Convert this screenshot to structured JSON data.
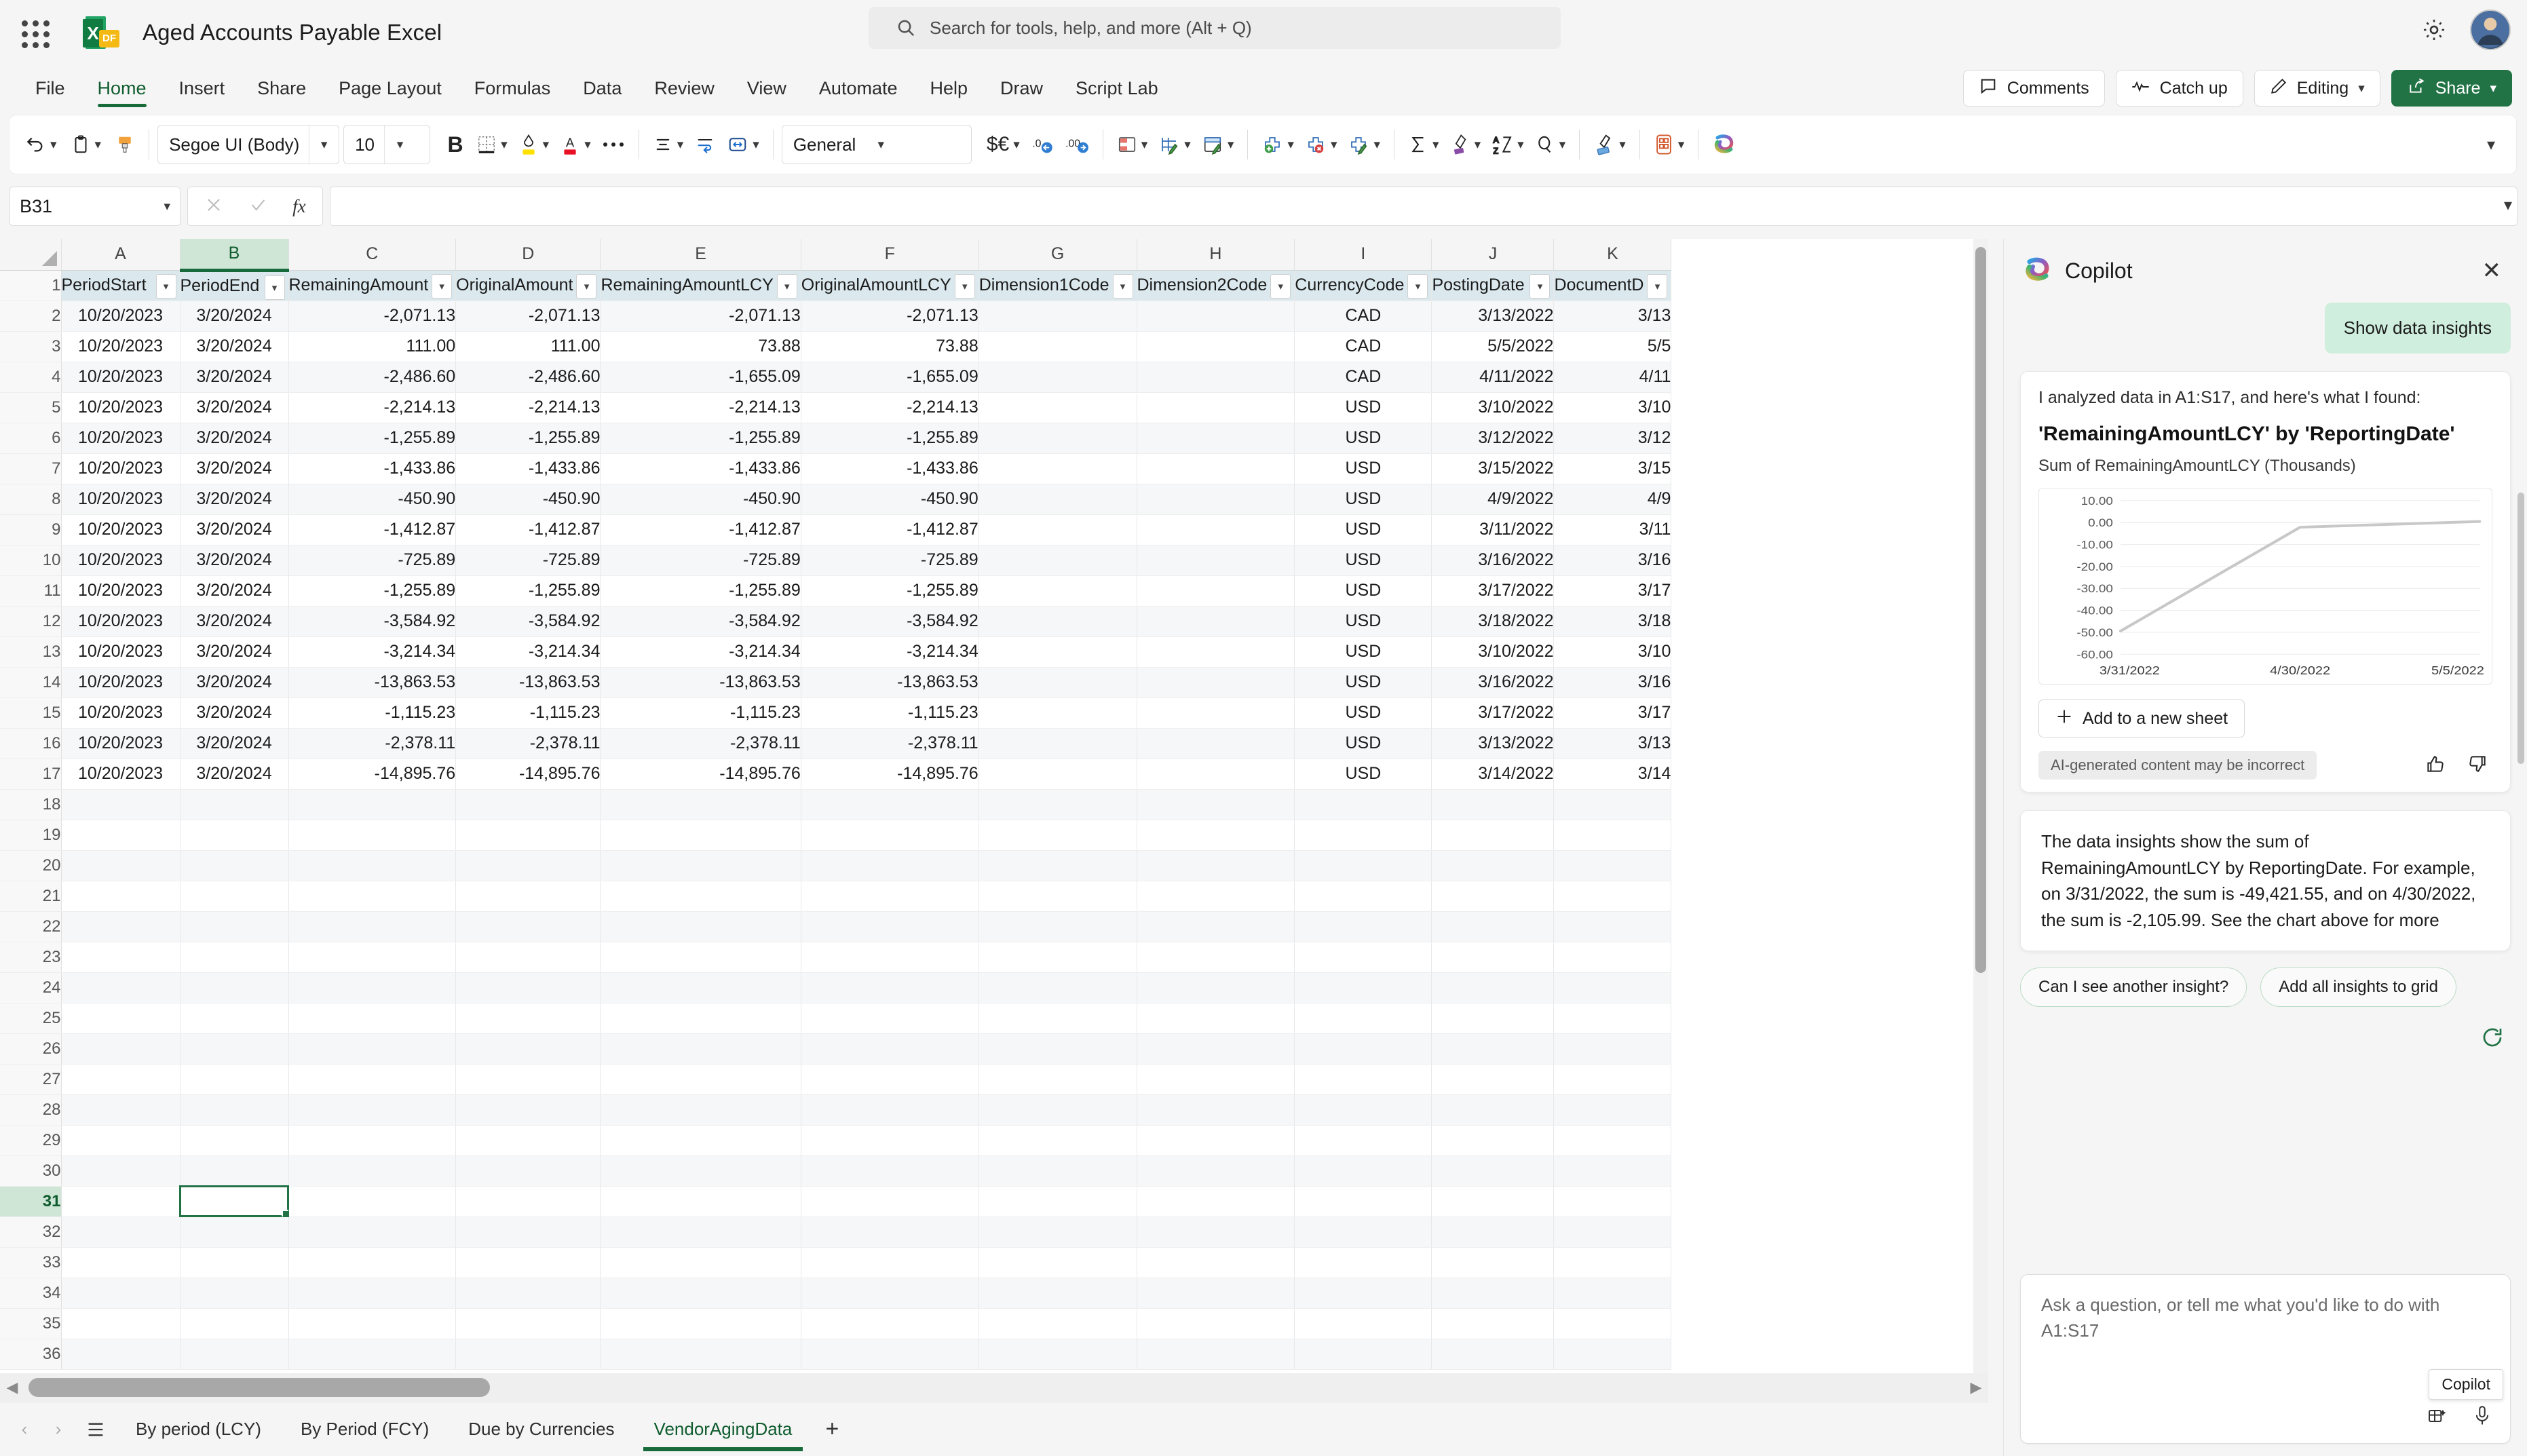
{
  "titlebar": {
    "waffle_label": "App launcher",
    "doc_title": "Aged Accounts Payable Excel",
    "search_placeholder": "Search for tools, help, and more (Alt + Q)"
  },
  "ribbon": {
    "tabs": [
      {
        "label": "File",
        "active": false
      },
      {
        "label": "Home",
        "active": true
      },
      {
        "label": "Insert",
        "active": false
      },
      {
        "label": "Share",
        "active": false
      },
      {
        "label": "Page Layout",
        "active": false
      },
      {
        "label": "Formulas",
        "active": false
      },
      {
        "label": "Data",
        "active": false
      },
      {
        "label": "Review",
        "active": false
      },
      {
        "label": "View",
        "active": false
      },
      {
        "label": "Automate",
        "active": false
      },
      {
        "label": "Help",
        "active": false
      },
      {
        "label": "Draw",
        "active": false
      },
      {
        "label": "Script Lab",
        "active": false
      }
    ],
    "comments_label": "Comments",
    "catchup_label": "Catch up",
    "editing_label": "Editing",
    "share_label": "Share",
    "accent_color": "#217346"
  },
  "toolbar": {
    "font_name": "Segoe UI (Body)",
    "font_size": "10",
    "bold_label": "B",
    "number_format": "General"
  },
  "formulabar": {
    "name_box": "B31",
    "formula_value": ""
  },
  "grid": {
    "columns": [
      "A",
      "B",
      "C",
      "D",
      "E",
      "F",
      "G",
      "H",
      "I",
      "J",
      "K"
    ],
    "selected_column": "B",
    "selected_row": 31,
    "selected_cell": "B31",
    "headers": [
      "PeriodStart",
      "PeriodEnd",
      "RemainingAmount",
      "OriginalAmount",
      "RemainingAmountLCY",
      "OriginalAmountLCY",
      "Dimension1Code",
      "Dimension2Code",
      "CurrencyCode",
      "PostingDate",
      "DocumentD"
    ],
    "rows": [
      {
        "n": 2,
        "cells": [
          "10/20/2023",
          "3/20/2024",
          "-2,071.13",
          "-2,071.13",
          "-2,071.13",
          "-2,071.13",
          "",
          "",
          "CAD",
          "3/13/2022",
          "3/13"
        ]
      },
      {
        "n": 3,
        "cells": [
          "10/20/2023",
          "3/20/2024",
          "111.00",
          "111.00",
          "73.88",
          "73.88",
          "",
          "",
          "CAD",
          "5/5/2022",
          "5/5"
        ]
      },
      {
        "n": 4,
        "cells": [
          "10/20/2023",
          "3/20/2024",
          "-2,486.60",
          "-2,486.60",
          "-1,655.09",
          "-1,655.09",
          "",
          "",
          "CAD",
          "4/11/2022",
          "4/11"
        ]
      },
      {
        "n": 5,
        "cells": [
          "10/20/2023",
          "3/20/2024",
          "-2,214.13",
          "-2,214.13",
          "-2,214.13",
          "-2,214.13",
          "",
          "",
          "USD",
          "3/10/2022",
          "3/10"
        ]
      },
      {
        "n": 6,
        "cells": [
          "10/20/2023",
          "3/20/2024",
          "-1,255.89",
          "-1,255.89",
          "-1,255.89",
          "-1,255.89",
          "",
          "",
          "USD",
          "3/12/2022",
          "3/12"
        ]
      },
      {
        "n": 7,
        "cells": [
          "10/20/2023",
          "3/20/2024",
          "-1,433.86",
          "-1,433.86",
          "-1,433.86",
          "-1,433.86",
          "",
          "",
          "USD",
          "3/15/2022",
          "3/15"
        ]
      },
      {
        "n": 8,
        "cells": [
          "10/20/2023",
          "3/20/2024",
          "-450.90",
          "-450.90",
          "-450.90",
          "-450.90",
          "",
          "",
          "USD",
          "4/9/2022",
          "4/9"
        ]
      },
      {
        "n": 9,
        "cells": [
          "10/20/2023",
          "3/20/2024",
          "-1,412.87",
          "-1,412.87",
          "-1,412.87",
          "-1,412.87",
          "",
          "",
          "USD",
          "3/11/2022",
          "3/11"
        ]
      },
      {
        "n": 10,
        "cells": [
          "10/20/2023",
          "3/20/2024",
          "-725.89",
          "-725.89",
          "-725.89",
          "-725.89",
          "",
          "",
          "USD",
          "3/16/2022",
          "3/16"
        ]
      },
      {
        "n": 11,
        "cells": [
          "10/20/2023",
          "3/20/2024",
          "-1,255.89",
          "-1,255.89",
          "-1,255.89",
          "-1,255.89",
          "",
          "",
          "USD",
          "3/17/2022",
          "3/17"
        ]
      },
      {
        "n": 12,
        "cells": [
          "10/20/2023",
          "3/20/2024",
          "-3,584.92",
          "-3,584.92",
          "-3,584.92",
          "-3,584.92",
          "",
          "",
          "USD",
          "3/18/2022",
          "3/18"
        ]
      },
      {
        "n": 13,
        "cells": [
          "10/20/2023",
          "3/20/2024",
          "-3,214.34",
          "-3,214.34",
          "-3,214.34",
          "-3,214.34",
          "",
          "",
          "USD",
          "3/10/2022",
          "3/10"
        ]
      },
      {
        "n": 14,
        "cells": [
          "10/20/2023",
          "3/20/2024",
          "-13,863.53",
          "-13,863.53",
          "-13,863.53",
          "-13,863.53",
          "",
          "",
          "USD",
          "3/16/2022",
          "3/16"
        ]
      },
      {
        "n": 15,
        "cells": [
          "10/20/2023",
          "3/20/2024",
          "-1,115.23",
          "-1,115.23",
          "-1,115.23",
          "-1,115.23",
          "",
          "",
          "USD",
          "3/17/2022",
          "3/17"
        ]
      },
      {
        "n": 16,
        "cells": [
          "10/20/2023",
          "3/20/2024",
          "-2,378.11",
          "-2,378.11",
          "-2,378.11",
          "-2,378.11",
          "",
          "",
          "USD",
          "3/13/2022",
          "3/13"
        ]
      },
      {
        "n": 17,
        "cells": [
          "10/20/2023",
          "3/20/2024",
          "-14,895.76",
          "-14,895.76",
          "-14,895.76",
          "-14,895.76",
          "",
          "",
          "USD",
          "3/14/2022",
          "3/14"
        ]
      },
      {
        "n": 18,
        "cells": [
          "",
          "",
          "",
          "",
          "",
          "",
          "",
          "",
          "",
          "",
          ""
        ]
      },
      {
        "n": 19,
        "cells": [
          "",
          "",
          "",
          "",
          "",
          "",
          "",
          "",
          "",
          "",
          ""
        ]
      },
      {
        "n": 20,
        "cells": [
          "",
          "",
          "",
          "",
          "",
          "",
          "",
          "",
          "",
          "",
          ""
        ]
      },
      {
        "n": 21,
        "cells": [
          "",
          "",
          "",
          "",
          "",
          "",
          "",
          "",
          "",
          "",
          ""
        ]
      },
      {
        "n": 22,
        "cells": [
          "",
          "",
          "",
          "",
          "",
          "",
          "",
          "",
          "",
          "",
          ""
        ]
      },
      {
        "n": 23,
        "cells": [
          "",
          "",
          "",
          "",
          "",
          "",
          "",
          "",
          "",
          "",
          ""
        ]
      },
      {
        "n": 24,
        "cells": [
          "",
          "",
          "",
          "",
          "",
          "",
          "",
          "",
          "",
          "",
          ""
        ]
      },
      {
        "n": 25,
        "cells": [
          "",
          "",
          "",
          "",
          "",
          "",
          "",
          "",
          "",
          "",
          ""
        ]
      },
      {
        "n": 26,
        "cells": [
          "",
          "",
          "",
          "",
          "",
          "",
          "",
          "",
          "",
          "",
          ""
        ]
      },
      {
        "n": 27,
        "cells": [
          "",
          "",
          "",
          "",
          "",
          "",
          "",
          "",
          "",
          "",
          ""
        ]
      },
      {
        "n": 28,
        "cells": [
          "",
          "",
          "",
          "",
          "",
          "",
          "",
          "",
          "",
          "",
          ""
        ]
      },
      {
        "n": 29,
        "cells": [
          "",
          "",
          "",
          "",
          "",
          "",
          "",
          "",
          "",
          "",
          ""
        ]
      },
      {
        "n": 30,
        "cells": [
          "",
          "",
          "",
          "",
          "",
          "",
          "",
          "",
          "",
          "",
          ""
        ]
      },
      {
        "n": 31,
        "cells": [
          "",
          "",
          "",
          "",
          "",
          "",
          "",
          "",
          "",
          "",
          ""
        ]
      },
      {
        "n": 32,
        "cells": [
          "",
          "",
          "",
          "",
          "",
          "",
          "",
          "",
          "",
          "",
          ""
        ]
      },
      {
        "n": 33,
        "cells": [
          "",
          "",
          "",
          "",
          "",
          "",
          "",
          "",
          "",
          "",
          ""
        ]
      },
      {
        "n": 34,
        "cells": [
          "",
          "",
          "",
          "",
          "",
          "",
          "",
          "",
          "",
          "",
          ""
        ]
      },
      {
        "n": 35,
        "cells": [
          "",
          "",
          "",
          "",
          "",
          "",
          "",
          "",
          "",
          "",
          ""
        ]
      },
      {
        "n": 36,
        "cells": [
          "",
          "",
          "",
          "",
          "",
          "",
          "",
          "",
          "",
          "",
          ""
        ]
      }
    ]
  },
  "sheettabs": {
    "tabs": [
      {
        "label": "By period (LCY)",
        "active": false
      },
      {
        "label": "By Period (FCY)",
        "active": false
      },
      {
        "label": "Due by Currencies",
        "active": false
      },
      {
        "label": "VendorAgingData",
        "active": true
      }
    ],
    "add_label": "+"
  },
  "copilot": {
    "title": "Copilot",
    "close_label": "✕",
    "user_message": "Show data insights",
    "card": {
      "intro": "I analyzed data in A1:S17, and here's what I found:",
      "insight_title": "'RemainingAmountLCY' by 'ReportingDate'",
      "insight_subtitle": "Sum of RemainingAmountLCY (Thousands)",
      "add_sheet_label": "Add to a new sheet",
      "ai_note": "AI-generated content may be incorrect"
    },
    "response_text": "The data insights show the sum of RemainingAmountLCY by ReportingDate. For example, on 3/31/2022, the sum is -49,421.55, and on 4/30/2022, the sum is -2,105.99. See the chart above for more",
    "suggestions": [
      "Can I see another insight?",
      "Add all insights to grid"
    ],
    "input_placeholder": "Ask a question, or tell me what you'd like to do with A1:S17",
    "tooltip": "Copilot"
  },
  "chart_data": {
    "type": "line",
    "title": "'RemainingAmountLCY' by 'ReportingDate'",
    "subtitle": "Sum of RemainingAmountLCY (Thousands)",
    "x": [
      "3/31/2022",
      "4/30/2022",
      "5/5/2022"
    ],
    "categories": [
      "3/31/2022",
      "4/30/2022",
      "5/5/2022"
    ],
    "values": [
      -49.42,
      -2.11,
      0.5
    ],
    "series": [
      {
        "name": "Sum of RemainingAmountLCY (Thousands)",
        "values": [
          -49.42,
          -2.11,
          0.5
        ]
      }
    ],
    "xlabel": "ReportingDate",
    "ylabel": "Sum of RemainingAmountLCY (Thousands)",
    "yticks": [
      10.0,
      0.0,
      -10.0,
      -20.0,
      -30.0,
      -40.0,
      -50.0,
      -60.0
    ],
    "ytick_labels": [
      "10.00",
      "0.00",
      "-10.00",
      "-20.00",
      "-30.00",
      "-40.00",
      "-50.00",
      "-60.00"
    ],
    "ylim": [
      -60,
      10
    ],
    "grid": true,
    "legend": "none",
    "line_color": "#c8c8c8"
  }
}
